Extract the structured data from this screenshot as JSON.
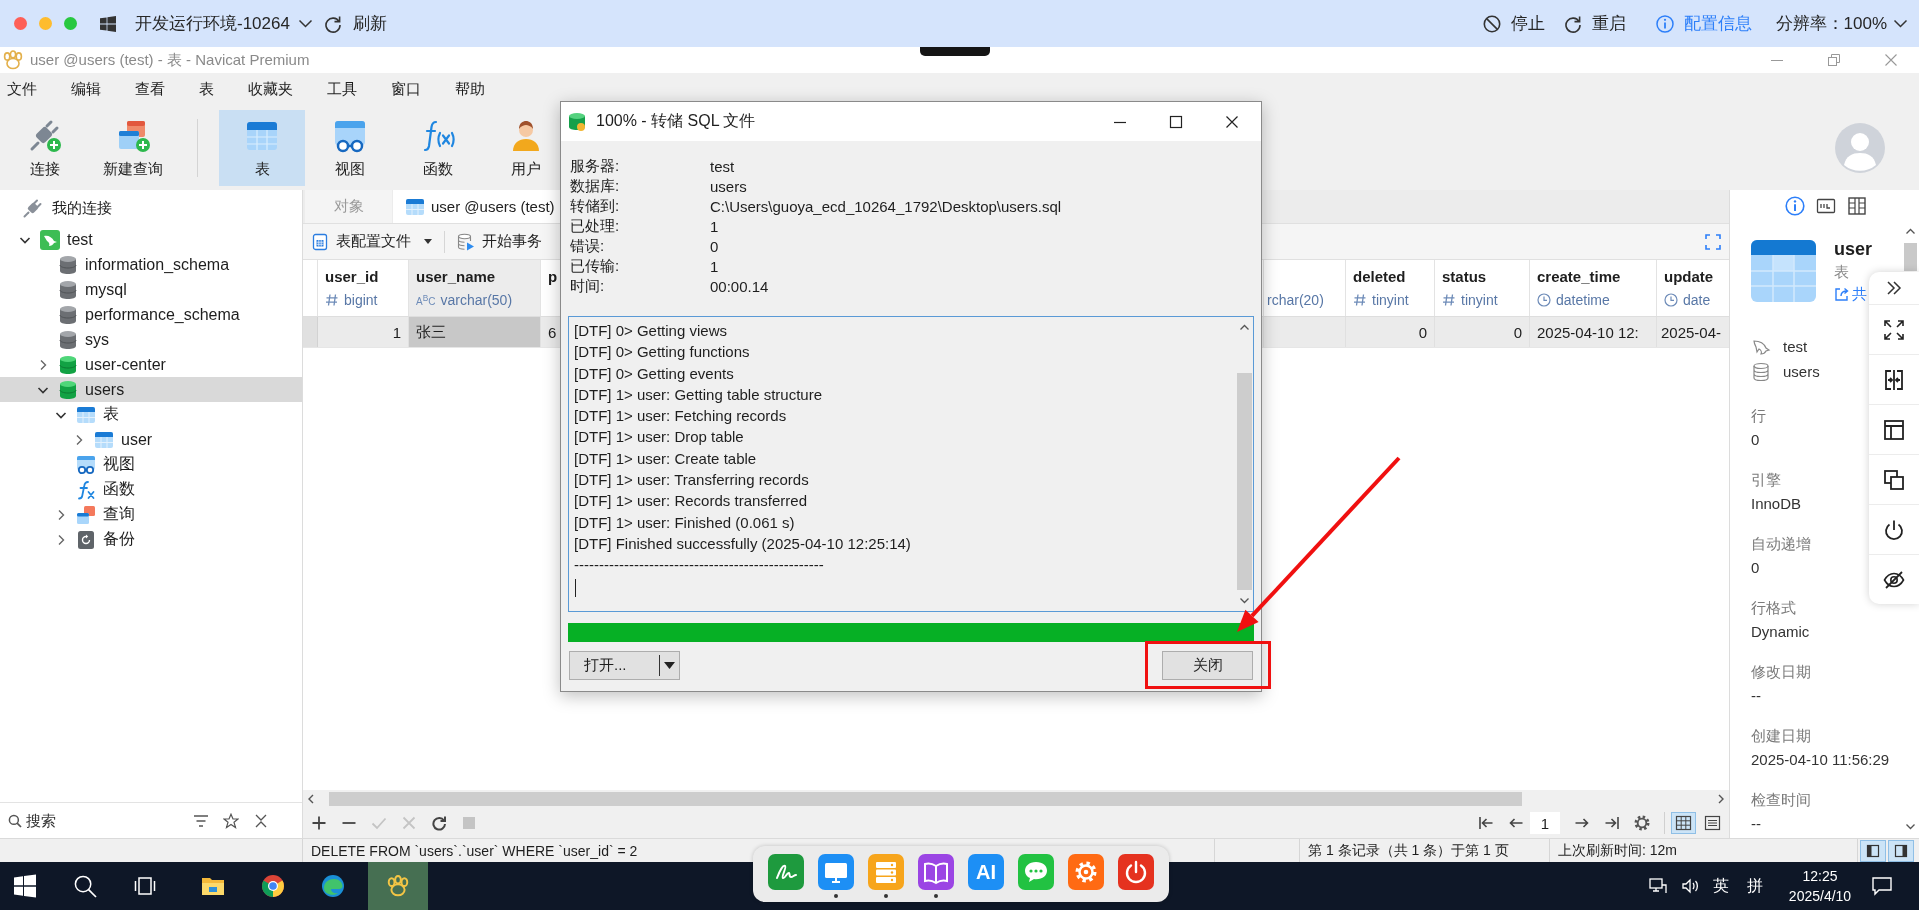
{
  "remote_bar": {
    "environment": "开发运行环境-10264",
    "refresh": "刷新",
    "actions": [
      {
        "kind": "stop",
        "label": "停止"
      },
      {
        "kind": "restart",
        "label": "重启"
      },
      {
        "kind": "config",
        "label": "配置信息"
      }
    ],
    "resolution": "分辨率：100%"
  },
  "window": {
    "title": "user @users (test) - 表 - Navicat Premium"
  },
  "menu": [
    "文件",
    "编辑",
    "查看",
    "表",
    "收藏夹",
    "工具",
    "窗口",
    "帮助"
  ],
  "toolbar": [
    {
      "kind": "connect",
      "label": "连接",
      "selected": false
    },
    {
      "kind": "new_query",
      "label": "新建查询",
      "selected": false
    },
    {
      "kind": "table",
      "label": "表",
      "selected": true
    },
    {
      "kind": "view",
      "label": "视图",
      "selected": false
    },
    {
      "kind": "function",
      "label": "函数",
      "selected": false
    },
    {
      "kind": "user",
      "label": "用户",
      "selected": false
    }
  ],
  "sidebar": {
    "header": "我的连接",
    "tree": [
      {
        "kind": "connection",
        "label": "test",
        "expanded": true,
        "selected": false,
        "children": [
          {
            "kind": "database",
            "label": "information_schema",
            "open": false,
            "selected": false
          },
          {
            "kind": "database",
            "label": "mysql",
            "open": false,
            "selected": false
          },
          {
            "kind": "database",
            "label": "performance_schema",
            "open": false,
            "selected": false
          },
          {
            "kind": "database",
            "label": "sys",
            "open": false,
            "selected": false
          },
          {
            "kind": "database",
            "label": "user-center",
            "open": true,
            "expanded": false,
            "selected": false
          },
          {
            "kind": "database",
            "label": "users",
            "open": true,
            "expanded": true,
            "selected": true,
            "children": [
              {
                "kind": "tables",
                "label": "表",
                "expanded": true,
                "selected": false,
                "children": [
                  {
                    "kind": "table",
                    "label": "user",
                    "expanded": false,
                    "selected": false
                  }
                ]
              },
              {
                "kind": "views",
                "label": "视图",
                "selected": false
              },
              {
                "kind": "functions",
                "label": "函数",
                "selected": false
              },
              {
                "kind": "queries",
                "label": "查询",
                "expanded": false,
                "selected": false
              },
              {
                "kind": "backups",
                "label": "备份",
                "expanded": false,
                "selected": false
              }
            ]
          }
        ]
      }
    ],
    "search": {
      "placeholder": "搜索"
    }
  },
  "tabs": [
    {
      "kind": "objects",
      "label": "对象",
      "selected": false
    },
    {
      "kind": "table",
      "label": "user @users (test)",
      "selected": true
    }
  ],
  "table_toolbar": [
    {
      "kind": "profile",
      "label": "表配置文件",
      "dropdown": true
    },
    {
      "kind": "transaction",
      "label": "开始事务",
      "dropdown": false
    }
  ],
  "grid": {
    "columns": [
      {
        "name": "user_id",
        "kind": "number",
        "type": "bigint"
      },
      {
        "name": "user_name",
        "kind": "text",
        "type_glyph": "A$^{B}$C",
        "type": "varchar(50)"
      },
      {
        "name": "p",
        "kind": "text"
      },
      {
        "kind": "text",
        "type": "rchar(20)"
      },
      {
        "name": "deleted",
        "kind": "number",
        "type": "tinyint"
      },
      {
        "name": "status",
        "kind": "number",
        "type": "tinyint"
      },
      {
        "name": "create_time",
        "kind": "datetime",
        "type": "datetime"
      },
      {
        "name": "update",
        "kind": "datetime",
        "type": "date"
      }
    ],
    "rows": [
      {
        "selected": true,
        "cells": [
          {
            "text": "1",
            "selected": false
          },
          {
            "text": "张三",
            "selected": true
          },
          {
            "text": "6",
            "selected": false
          },
          {
            "selected": false
          },
          {
            "text": "0",
            "selected": false
          },
          {
            "text": "0",
            "selected": false
          },
          {
            "text": "2025-04-10 12:",
            "selected": false
          },
          {
            "text": "2025-04-",
            "selected": false
          }
        ]
      }
    ]
  },
  "edit_buttons": [
    {
      "kind": "add",
      "disabled": false
    },
    {
      "kind": "remove",
      "disabled": false
    },
    {
      "kind": "apply",
      "disabled": true
    },
    {
      "kind": "discard",
      "disabled": true
    },
    {
      "kind": "refresh",
      "disabled": false
    },
    {
      "kind": "stop",
      "disabled": true
    }
  ],
  "pager": {
    "page": "1",
    "view_modes": [
      {
        "kind": "grid",
        "selected": true
      },
      {
        "kind": "form",
        "selected": false
      }
    ]
  },
  "info_panel": {
    "tabs": [
      {
        "kind": "info",
        "selected": true
      },
      {
        "kind": "ddl",
        "selected": false
      },
      {
        "kind": "columns",
        "selected": false
      }
    ],
    "name": "user",
    "type": "表",
    "share": "共",
    "connection": "test",
    "database": "users",
    "properties": [
      {
        "label": "行",
        "value": "0"
      },
      {
        "label": "引擎",
        "value": "InnoDB"
      },
      {
        "label": "自动递增",
        "value": "0"
      },
      {
        "label": "行格式",
        "value": "Dynamic"
      },
      {
        "label": "修改日期",
        "value": "--"
      },
      {
        "label": "创建日期",
        "value": "2025-04-10 11:56:29"
      },
      {
        "label": "检查时间",
        "value": "--"
      }
    ]
  },
  "side_tools": [
    {
      "kind": "collapse"
    },
    {
      "kind": "fullscreen"
    },
    {
      "kind": "split"
    },
    {
      "kind": "layout"
    },
    {
      "kind": "copy"
    },
    {
      "kind": "power"
    },
    {
      "kind": "hide"
    }
  ],
  "status_bar": {
    "sql": "DELETE FROM `users`.`user` WHERE `user_id` = 2",
    "records": "第 1 条记录（共 1 条）于第 1 页",
    "refreshed": "上次刷新时间: 12m",
    "panels": [
      {
        "kind": "left",
        "selected": true
      },
      {
        "kind": "right",
        "selected": true
      }
    ]
  },
  "dialog": {
    "title": "100% - 转储 SQL 文件",
    "info": [
      {
        "label": "服务器:",
        "value": "test"
      },
      {
        "label": "数据库:",
        "value": "users"
      },
      {
        "label": "转储到:",
        "value": "C:\\Users\\guoya_ecd_10264_1792\\Desktop\\users.sql"
      },
      {
        "label": "已处理:",
        "value": "1"
      },
      {
        "label": "错误:",
        "value": "0"
      },
      {
        "label": "已传输:",
        "value": "1"
      },
      {
        "label": "时间:",
        "value": "00:00.14"
      }
    ],
    "log": [
      "[DTF] 0> Getting views",
      "[DTF] 0> Getting functions",
      "[DTF] 0> Getting events",
      "[DTF] 1> user: Getting table structure",
      "[DTF] 1> user: Fetching records",
      "[DTF] 1> user: Drop table",
      "[DTF] 1> user: Create table",
      "[DTF] 1> user: Transferring records",
      "[DTF] 1> user: Records transferred",
      "[DTF] 1> user: Finished (0.061 s)",
      "[DTF] Finished successfully (2025-04-10 12:25:14)",
      "--------------------------------------------------"
    ],
    "progress": {
      "level": 1
    },
    "buttons": [
      {
        "kind": "split",
        "label": "打开..."
      },
      {
        "kind": "plain",
        "label": "关闭"
      }
    ]
  },
  "annotations": {
    "highlight_box": true,
    "arrow": true
  },
  "dock": [
    {
      "kind": "sign",
      "running": false
    },
    {
      "kind": "monitor",
      "running": true
    },
    {
      "kind": "server",
      "running": true
    },
    {
      "kind": "book",
      "running": true
    },
    {
      "kind": "ai",
      "label": "AI",
      "running": false
    },
    {
      "kind": "chat",
      "running": false
    },
    {
      "kind": "settings",
      "running": false
    },
    {
      "kind": "power",
      "running": false
    }
  ],
  "taskbar": {
    "apps": [
      {
        "kind": "start",
        "active": false
      },
      {
        "kind": "search",
        "active": false
      },
      {
        "kind": "task_view",
        "active": false
      },
      {
        "kind": "explorer",
        "active": false
      },
      {
        "kind": "chrome",
        "active": false
      },
      {
        "kind": "edge",
        "active": false
      },
      {
        "kind": "navicat",
        "active": true
      }
    ],
    "tray": {
      "input_lang": "英",
      "input_mode": "拼",
      "time": "12:25",
      "date": "2025/4/10"
    }
  }
}
